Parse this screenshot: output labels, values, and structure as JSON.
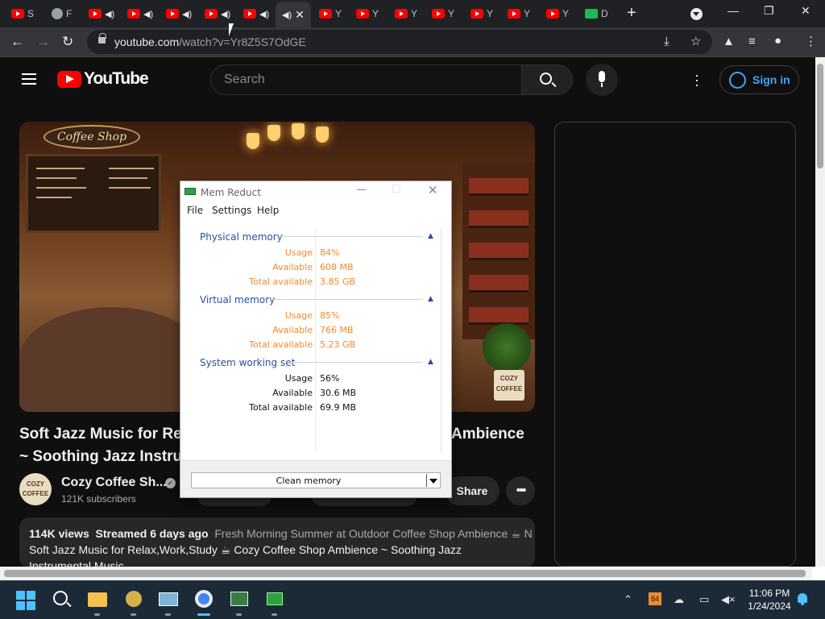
{
  "browser": {
    "tabs": [
      {
        "label": "S",
        "icon": "youtube-icon",
        "audio": false
      },
      {
        "label": "F",
        "icon": "globe-icon",
        "audio": false
      },
      {
        "label": "",
        "icon": "youtube-icon",
        "audio": true
      },
      {
        "label": "",
        "icon": "youtube-icon",
        "audio": true
      },
      {
        "label": "",
        "icon": "youtube-icon",
        "audio": true
      },
      {
        "label": "",
        "icon": "youtube-icon",
        "audio": true
      },
      {
        "label": "",
        "icon": "youtube-icon",
        "audio": true
      },
      {
        "label": "",
        "icon": "speaker-icon",
        "audio": true,
        "active": true
      },
      {
        "label": "Y",
        "icon": "youtube-icon",
        "audio": false
      },
      {
        "label": "Y",
        "icon": "youtube-icon",
        "audio": false
      },
      {
        "label": "Y",
        "icon": "youtube-icon",
        "audio": false
      },
      {
        "label": "Y",
        "icon": "youtube-icon",
        "audio": false
      },
      {
        "label": "Y",
        "icon": "youtube-icon",
        "audio": false
      },
      {
        "label": "Y",
        "icon": "youtube-icon",
        "audio": false
      },
      {
        "label": "Y",
        "icon": "youtube-icon",
        "audio": false
      },
      {
        "label": "D",
        "icon": "green-app-icon",
        "audio": false
      }
    ],
    "url_host": "youtube.com",
    "url_path": "/watch?v=Yr8Z5S7OdGE"
  },
  "youtube": {
    "logo_text": "YouTube",
    "search_placeholder": "Search",
    "signin_label": "Sign in",
    "video_title": "Soft Jazz Music for Re… Ambience ~ Soothing Jazz Instru…",
    "video_title_line1_left": "Soft Jazz Music for Re",
    "video_title_line1_right": "Ambience",
    "video_title_line2": "~ Soothing Jazz Instru",
    "thumbnail_sign": "Coffee Shop",
    "channel_badge": "COZY COFFEE",
    "channel_name": "Cozy Coffee Sh...",
    "subscribers": "121K subscribers",
    "share_label": "Share",
    "more_label": "•••",
    "desc_views": "114K views",
    "desc_streamed": "Streamed 6 days ago",
    "desc_line1_rest": "Fresh Morning Summer at Outdoor Coffee Shop Ambience ☕ N",
    "desc_line2": "Soft Jazz Music for Relax,Work,Study ☕ Cozy Coffee Shop Ambience ~ Soothing Jazz",
    "desc_line3": "Instrumental Music"
  },
  "memreduct": {
    "title": "Mem Reduct",
    "menu": [
      "File",
      "Settings",
      "Help"
    ],
    "groups": [
      {
        "name": "Physical memory",
        "rows": [
          {
            "key": "Usage",
            "value": "84%"
          },
          {
            "key": "Available",
            "value": "608 MB"
          },
          {
            "key": "Total available",
            "value": "3.85 GB"
          }
        ]
      },
      {
        "name": "Virtual memory",
        "rows": [
          {
            "key": "Usage",
            "value": "85%"
          },
          {
            "key": "Available",
            "value": "766 MB"
          },
          {
            "key": "Total available",
            "value": "5.23 GB"
          }
        ]
      },
      {
        "name": "System working set",
        "rows": [
          {
            "key": "Usage",
            "value": "56%"
          },
          {
            "key": "Available",
            "value": "30.6 MB"
          },
          {
            "key": "Total available",
            "value": "69.9 MB"
          }
        ]
      }
    ],
    "clean_label": "Clean memory",
    "accent_color": "#f08a30",
    "group_color": "#2a4ea0"
  },
  "taskbar": {
    "time": "11:06 PM",
    "date": "1/24/2024",
    "apps": [
      "start-icon",
      "search-icon",
      "file-explorer-icon",
      "bee-app-icon",
      "photos-icon",
      "chrome-icon",
      "terminal-app-icon",
      "mem-reduct-icon"
    ],
    "tray_badge": "84"
  }
}
